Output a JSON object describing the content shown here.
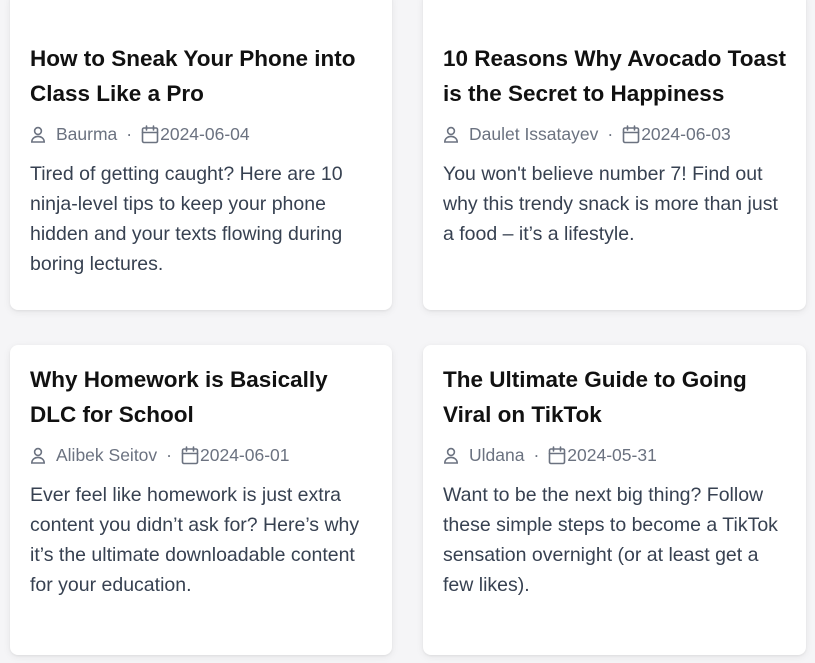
{
  "posts": [
    {
      "title": "How to Sneak Your Phone into Class Like a Pro",
      "author": "Baurma",
      "date": "2024-06-04",
      "excerpt": "Tired of getting caught? Here are 10 ninja-level tips to keep your phone hidden and your texts flowing during boring lectures."
    },
    {
      "title": "10 Reasons Why Avocado Toast is the Secret to Happiness",
      "author": "Daulet Issatayev",
      "date": "2024-06-03",
      "excerpt": "You won't believe number 7! Find out why this trendy snack is more than just a food – it’s a lifestyle."
    },
    {
      "title": "Why Homework is Basically DLC for School",
      "author": "Alibek Seitov",
      "date": "2024-06-01",
      "excerpt": "Ever feel like homework is just extra content you didn’t ask for? Here’s why it’s the ultimate downloadable content for your education."
    },
    {
      "title": "The Ultimate Guide to Going Viral on TikTok",
      "author": "Uldana",
      "date": "2024-05-31",
      "excerpt": "Want to be the next big thing? Follow these simple steps to become a TikTok sensation overnight (or at least get a few likes)."
    }
  ],
  "meta_separator": "·",
  "icons": {
    "author": "user-icon",
    "date": "calendar-icon"
  }
}
